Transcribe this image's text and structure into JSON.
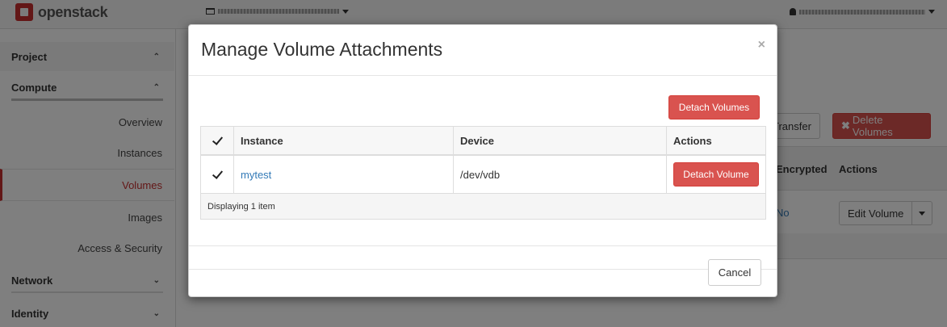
{
  "header": {
    "brand": "openstack"
  },
  "sidebar": {
    "sections": [
      {
        "label": "Project",
        "chevron": "^"
      },
      {
        "label": "Compute",
        "chevron": "^"
      },
      {
        "label": "Network",
        "chevron": "v"
      },
      {
        "label": "Identity",
        "chevron": "v"
      }
    ],
    "items": [
      {
        "label": "Overview"
      },
      {
        "label": "Instances"
      },
      {
        "label": "Volumes",
        "active": true
      },
      {
        "label": "Images"
      },
      {
        "label": "Access & Security"
      }
    ]
  },
  "main": {
    "transfer_button": "t Transfer",
    "delete_volumes_button": "Delete Volumes",
    "table_headers": {
      "encrypted": "Encrypted",
      "actions": "Actions"
    },
    "row": {
      "encrypted": "No",
      "edit_volume_button": "Edit Volume"
    }
  },
  "modal": {
    "title": "Manage Volume Attachments",
    "close_glyph": "×",
    "detach_volumes_button": "Detach Volumes",
    "table": {
      "headers": {
        "instance": "Instance",
        "device": "Device",
        "actions": "Actions"
      },
      "rows": [
        {
          "instance": "mytest",
          "device": "/dev/vdb",
          "action": "Detach Volume",
          "checked": true
        }
      ],
      "footer": "Displaying 1 item"
    },
    "cancel_button": "Cancel"
  },
  "colors": {
    "accent": "#c72f2f",
    "danger": "#d9534f",
    "link": "#337ab7",
    "overlay": "rgba(0,0,0,0.5)"
  }
}
